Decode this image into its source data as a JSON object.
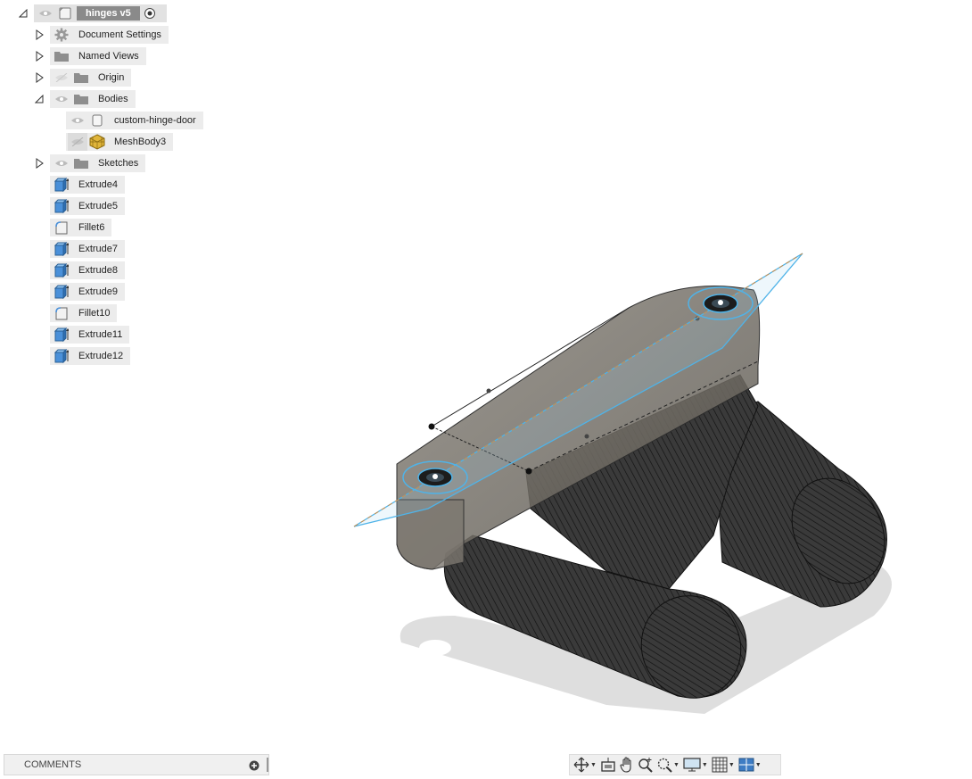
{
  "browser": {
    "root": {
      "label": "hinges v5"
    },
    "items": [
      {
        "label": "Document Settings"
      },
      {
        "label": "Named Views"
      },
      {
        "label": "Origin"
      },
      {
        "label": "Bodies"
      },
      {
        "label": "custom-hinge-door"
      },
      {
        "label": "MeshBody3"
      },
      {
        "label": "Sketches"
      }
    ]
  },
  "timeline": {
    "features": [
      {
        "label": "Extrude4",
        "icon": "extrude-icon"
      },
      {
        "label": "Extrude5",
        "icon": "extrude-icon"
      },
      {
        "label": "Fillet6",
        "icon": "fillet-icon"
      },
      {
        "label": "Extrude7",
        "icon": "extrude-icon"
      },
      {
        "label": "Extrude8",
        "icon": "extrude-icon"
      },
      {
        "label": "Extrude9",
        "icon": "extrude-icon"
      },
      {
        "label": "Fillet10",
        "icon": "fillet-icon"
      },
      {
        "label": "Extrude11",
        "icon": "extrude-icon"
      },
      {
        "label": "Extrude12",
        "icon": "extrude-icon"
      }
    ]
  },
  "comments": {
    "label": "COMMENTS"
  },
  "colors": {
    "selection": "#4fb3e8",
    "body_dark": "#2e2e2e",
    "body_face": "#6e6a62",
    "chip_bg": "#ececec",
    "folder": "#8e8e8e"
  }
}
